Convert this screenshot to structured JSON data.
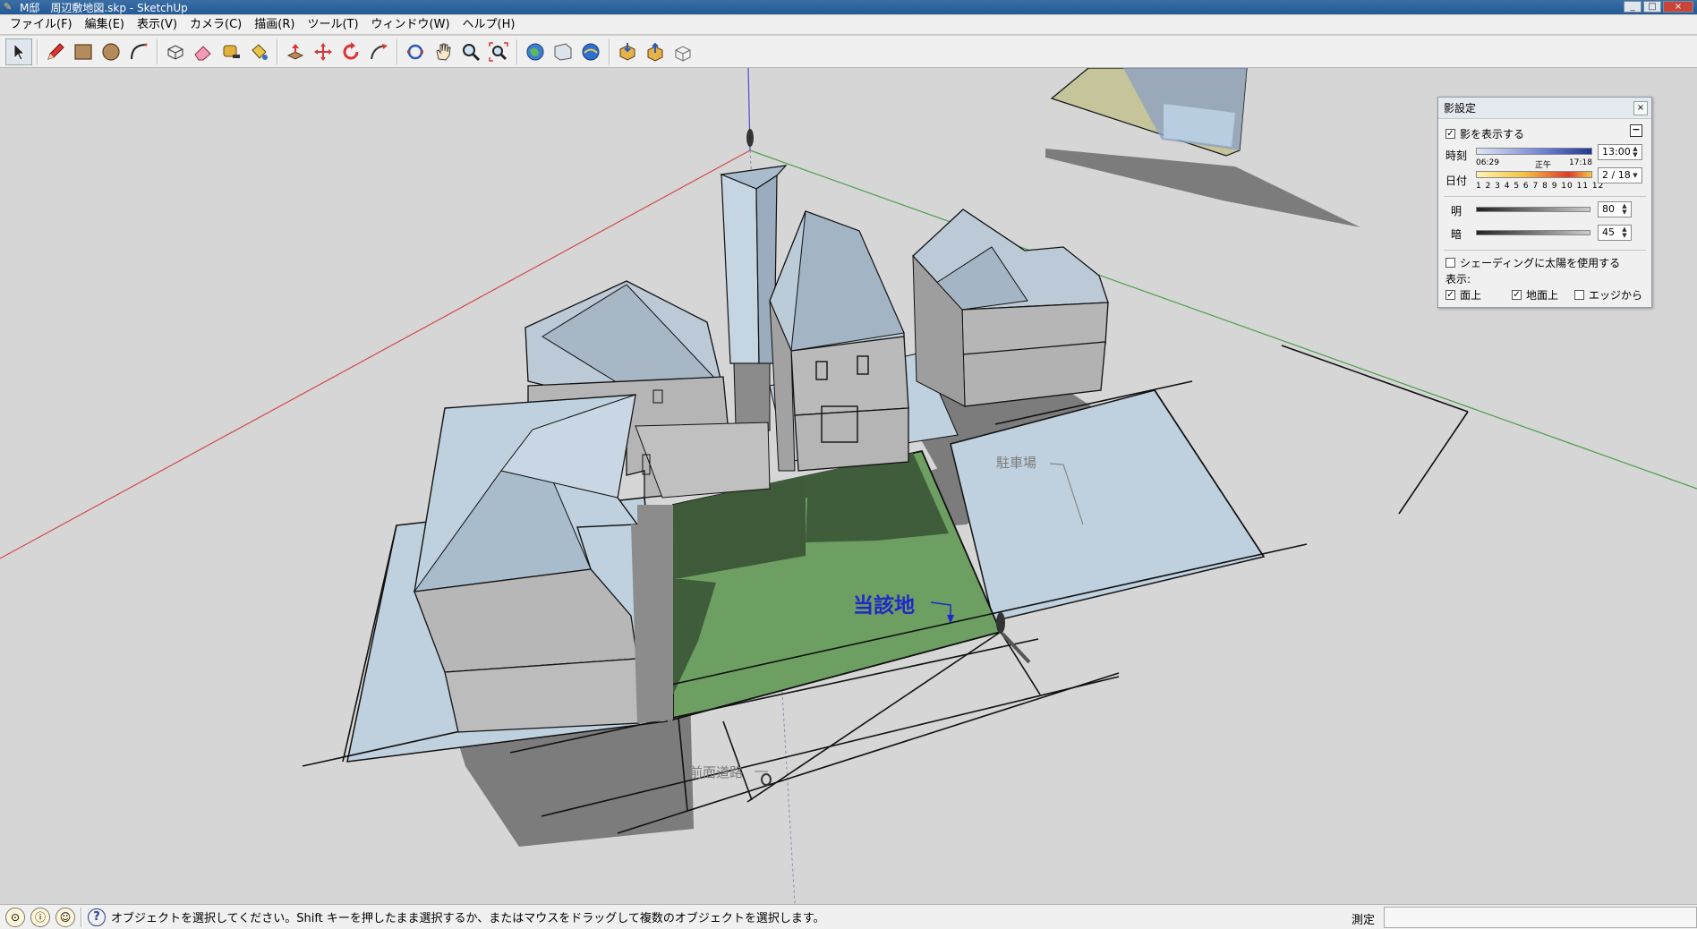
{
  "window": {
    "title": "M邸　周辺敷地図.skp - SketchUp",
    "buttons": [
      "_",
      "□",
      "×"
    ]
  },
  "menu": [
    "ファイル(F)",
    "編集(E)",
    "表示(V)",
    "カメラ(C)",
    "描画(R)",
    "ツール(T)",
    "ウィンドウ(W)",
    "ヘルプ(H)"
  ],
  "toolbar": {
    "tools": [
      "select-icon",
      "pencil-icon",
      "rectangle-icon",
      "circle-icon",
      "arc-icon",
      "make-component-icon",
      "eraser-icon",
      "tape-measure-icon",
      "paint-bucket-icon",
      "push-pull-icon",
      "move-icon",
      "rotate-icon",
      "follow-me-icon",
      "orbit-icon",
      "pan-icon",
      "zoom-icon",
      "zoom-extents-icon",
      "geo-location-icon",
      "photo-texture-icon",
      "3d-warehouse-icon",
      "get-models-icon",
      "share-model-icon",
      "extension-warehouse-icon"
    ]
  },
  "viewport": {
    "labels": {
      "subject": "当該地",
      "parking": "駐車場",
      "road": "前面道路"
    },
    "colors": {
      "background": "#d6d6d6",
      "site_green": "#6d9e62",
      "site_shadow": "#3e5e3a",
      "ground_blue": "#bdd0dc",
      "roof_blue": "#b5c7d6",
      "wall_gray": "#b9b9b9",
      "shadow": "#7a7a7a",
      "axis_red": "#d24a4a",
      "axis_green": "#4aa04a",
      "axis_blue": "#4a4ad2"
    }
  },
  "shadow_panel": {
    "title": "影設定",
    "close": "×",
    "show_shadows": {
      "label": "影を表示する",
      "checked": true
    },
    "toggle": "−",
    "time": {
      "label": "時刻",
      "start": "06:29",
      "noon": "正午",
      "end": "17:18",
      "value": "13:00"
    },
    "date": {
      "label": "日付",
      "months": "1 2 3 4 5 6 7 8 9 10 11 12",
      "value": "2 / 18"
    },
    "light": {
      "label": "明",
      "value": "80"
    },
    "dark": {
      "label": "暗",
      "value": "45"
    },
    "use_sun_shading": {
      "label": "シェーディングに太陽を使用する",
      "checked": false
    },
    "display_label": "表示:",
    "on_faces": {
      "label": "面上",
      "checked": true
    },
    "on_ground": {
      "label": "地面上",
      "checked": true
    },
    "from_edges": {
      "label": "エッジから",
      "checked": false
    }
  },
  "statusbar": {
    "icons": [
      "geo-icon",
      "credit-icon",
      "user-icon"
    ],
    "help": "?",
    "message": "オブジェクトを選択してください。Shift キーを押したまま選択するか、またはマウスをドラッグして複数のオブジェクトを選択します。",
    "measure_label": "測定"
  }
}
